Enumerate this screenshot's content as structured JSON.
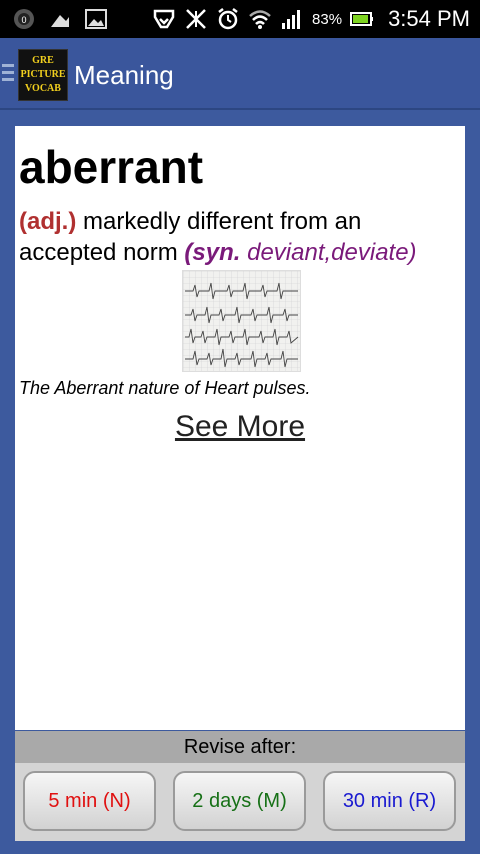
{
  "status_bar": {
    "battery_percent": "83%",
    "time": "3:54 PM",
    "icons": [
      "vpn-icon",
      "notification-icon",
      "image-icon",
      "cast-icon",
      "mute-icon",
      "alarm-icon",
      "wifi-icon",
      "signal-icon",
      "battery-icon"
    ]
  },
  "action_bar": {
    "logo_lines": [
      "GRE",
      "PICTURE",
      "VOCAB"
    ],
    "title": "Meaning"
  },
  "entry": {
    "word": "aberrant",
    "part_of_speech": "(adj.)",
    "definition": " markedly different from an accepted norm ",
    "syn_label": "(syn.",
    "synonyms": " deviant,deviate)",
    "image_caption": "The Aberrant nature of Heart pulses.",
    "see_more": "See More"
  },
  "revise": {
    "label": "Revise after:",
    "buttons": [
      "5 min (N)",
      "2 days (M)",
      "30 min (R)"
    ],
    "colors": [
      "#e01010",
      "#167016",
      "#1a1ad0"
    ]
  }
}
